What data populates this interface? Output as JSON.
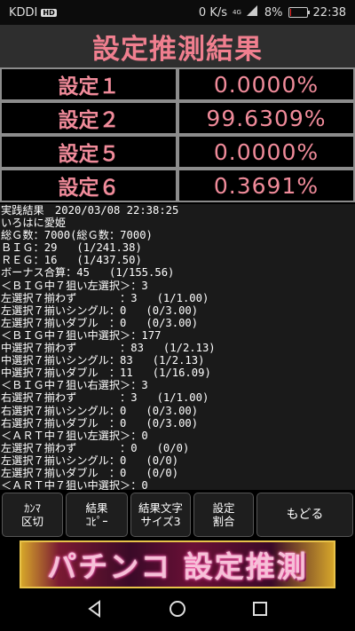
{
  "status_bar": {
    "carrier": "KDDI",
    "hd_badge": "HD",
    "net_speed": "0 K/s",
    "network": "4G",
    "battery": "8%",
    "battery_level": 0.08,
    "time": "22:38"
  },
  "title": "設定推測結果",
  "settings": [
    {
      "name": "設定１",
      "value": "0.0000%"
    },
    {
      "name": "設定２",
      "value": "99.6309%"
    },
    {
      "name": "設定５",
      "value": "0.0000%"
    },
    {
      "name": "設定６",
      "value": "0.3691%"
    }
  ],
  "log_lines": [
    "実践結果　2020/03/08 22:38:25",
    "いろはに愛姫",
    "総Ｇ数：7000(総Ｇ数：7000)",
    "ＢＩＧ：29   (1/241.38)",
    "ＲＥＧ：16   (1/437.50)",
    "ボーナス合算：45   (1/155.56)",
    "＜ＢＩＧ中７狙い左選択＞：3",
    "左選択７揃わず　　　　：3   (1/1.00)",
    "左選択７揃いシングル：0   (0/3.00)",
    "左選択７揃いダブル　：0   (0/3.00)",
    "＜ＢＩＧ中７狙い中選択＞：177",
    "中選択７揃わず　　　　：83   (1/2.13)",
    "中選択７揃いシングル：83   (1/2.13)",
    "中選択７揃いダブル　：11   (1/16.09)",
    "＜ＢＩＧ中７狙い右選択＞：3",
    "右選択７揃わず　　　　：3   (1/1.00)",
    "右選択７揃いシングル：0   (0/3.00)",
    "右選択７揃いダブル　：0   (0/3.00)",
    "＜ＡＲＴ中７狙い左選択＞：0",
    "左選択７揃わず　　　　：0   (0/0)",
    "左選択７揃いシングル：0   (0/0)",
    "左選択７揃いダブル　：0   (0/0)",
    "＜ＡＲＴ中７狙い中選択＞：0"
  ],
  "buttons": {
    "comma": {
      "line1": "ｶﾝﾏ",
      "line2": "区切"
    },
    "copy": {
      "line1": "結果",
      "line2": "ｺﾋﾟｰ"
    },
    "fontsize": {
      "line1": "結果文字",
      "line2": "サイズ3"
    },
    "ratio": {
      "line1": "設定",
      "line2": "割合"
    },
    "back": {
      "line1": "もどる"
    }
  },
  "banner_text": "パチンコ 設定推測",
  "nav": [
    "back-triangle-icon",
    "home-circle-icon",
    "recents-square-icon"
  ]
}
